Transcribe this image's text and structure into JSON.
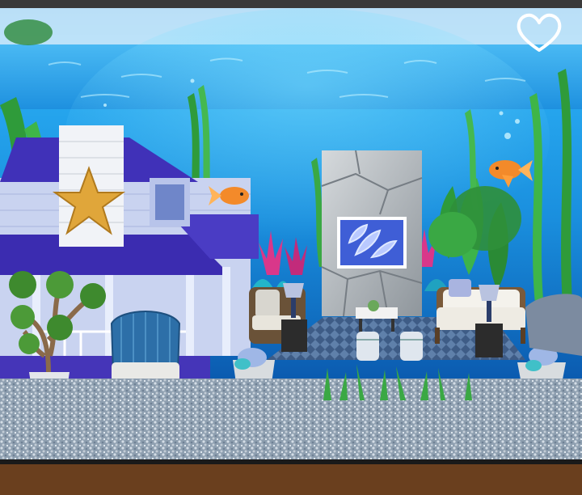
{
  "ui": {
    "favorite_icon": "heart-outline-icon"
  },
  "colors": {
    "water_top": "#0a6fd0",
    "water_mid": "#1e9fea",
    "water_bottom": "#0b5fb8",
    "gravel": "#a7b6c4",
    "house_roof": "#3b2fb5",
    "house_wall": "#cfd8f2",
    "fish": "#f38a2a",
    "floor": "#6a3f1e"
  }
}
